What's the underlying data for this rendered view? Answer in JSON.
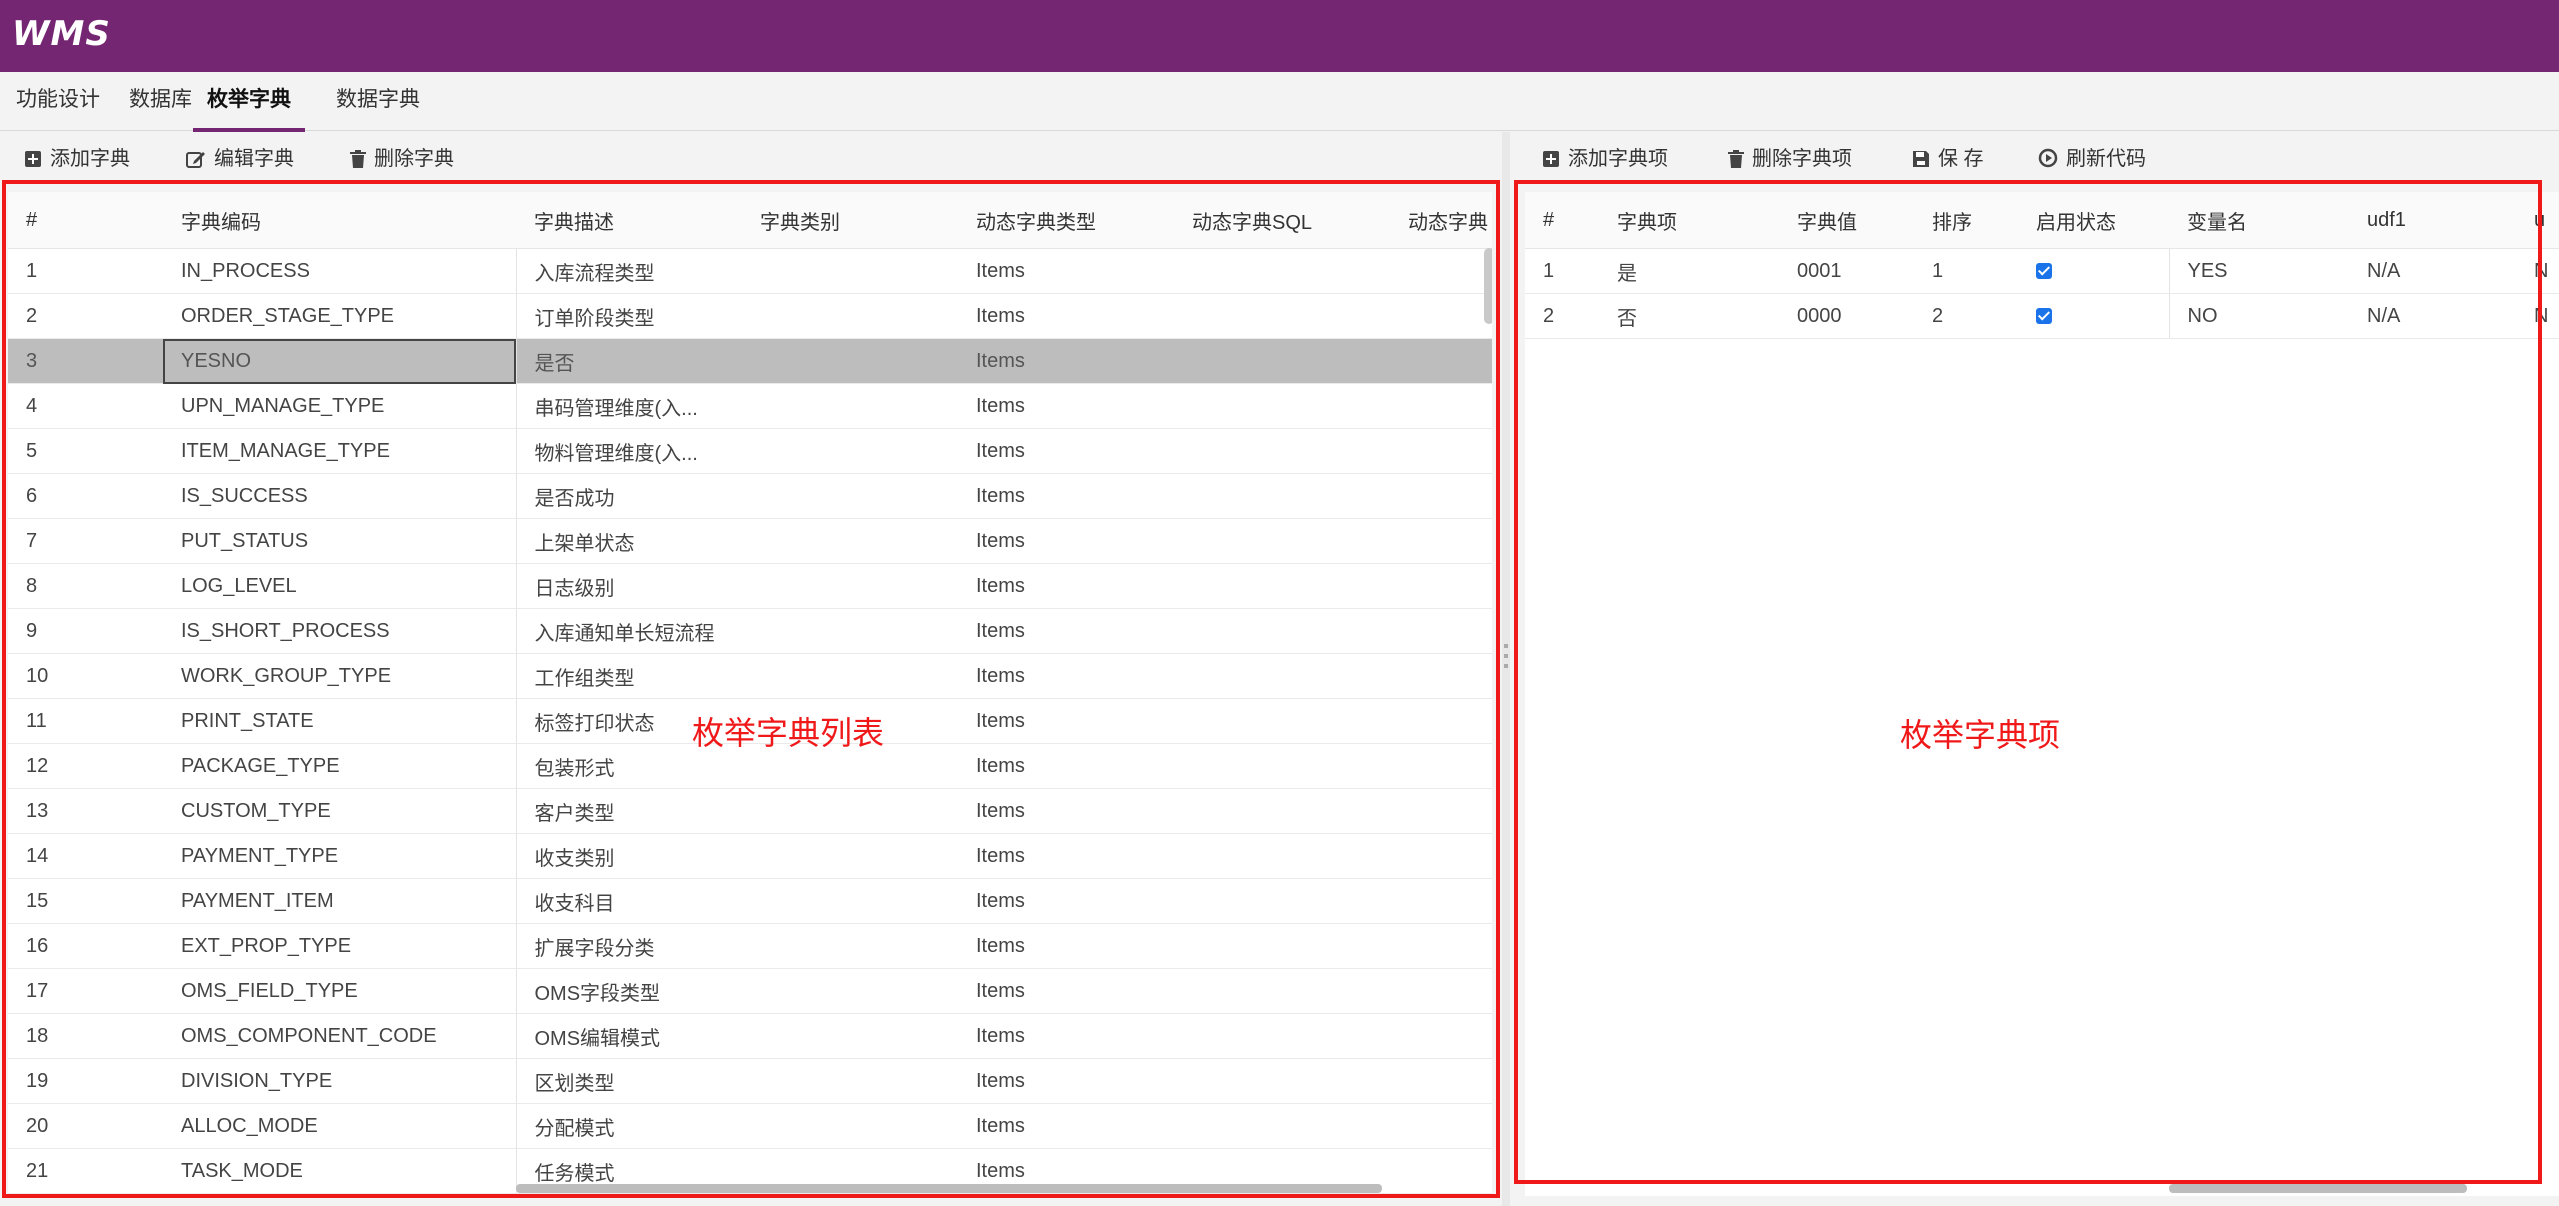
{
  "app": {
    "logo": "WMS",
    "accent": "#742673"
  },
  "tabs": [
    {
      "label": "功能设计",
      "active": false
    },
    {
      "label": "数据库",
      "active": false
    },
    {
      "label": "枚举字典",
      "active": true
    },
    {
      "label": "数据字典",
      "active": false
    }
  ],
  "left_toolbar": {
    "add": "添加字典",
    "edit": "编辑字典",
    "delete": "删除字典"
  },
  "right_toolbar": {
    "add": "添加字典项",
    "delete": "删除字典项",
    "save": "保 存",
    "refresh": "刷新代码"
  },
  "left_table": {
    "columns": [
      "#",
      "字典编码",
      "字典描述",
      "字典类别",
      "动态字典类型",
      "动态字典SQL",
      "动态字典"
    ],
    "rows": [
      [
        "1",
        "IN_PROCESS",
        "入库流程类型",
        "",
        "Items"
      ],
      [
        "2",
        "ORDER_STAGE_TYPE",
        "订单阶段类型",
        "",
        "Items"
      ],
      [
        "3",
        "YESNO",
        "是否",
        "",
        "Items"
      ],
      [
        "4",
        "UPN_MANAGE_TYPE",
        "串码管理维度(入...",
        "",
        "Items"
      ],
      [
        "5",
        "ITEM_MANAGE_TYPE",
        "物料管理维度(入...",
        "",
        "Items"
      ],
      [
        "6",
        "IS_SUCCESS",
        "是否成功",
        "",
        "Items"
      ],
      [
        "7",
        "PUT_STATUS",
        "上架单状态",
        "",
        "Items"
      ],
      [
        "8",
        "LOG_LEVEL",
        "日志级别",
        "",
        "Items"
      ],
      [
        "9",
        "IS_SHORT_PROCESS",
        "入库通知单长短流程",
        "",
        "Items"
      ],
      [
        "10",
        "WORK_GROUP_TYPE",
        "工作组类型",
        "",
        "Items"
      ],
      [
        "11",
        "PRINT_STATE",
        "标签打印状态",
        "",
        "Items"
      ],
      [
        "12",
        "PACKAGE_TYPE",
        "包装形式",
        "",
        "Items"
      ],
      [
        "13",
        "CUSTOM_TYPE",
        "客户类型",
        "",
        "Items"
      ],
      [
        "14",
        "PAYMENT_TYPE",
        "收支类别",
        "",
        "Items"
      ],
      [
        "15",
        "PAYMENT_ITEM",
        "收支科目",
        "",
        "Items"
      ],
      [
        "16",
        "EXT_PROP_TYPE",
        "扩展字段分类",
        "",
        "Items"
      ],
      [
        "17",
        "OMS_FIELD_TYPE",
        "OMS字段类型",
        "",
        "Items"
      ],
      [
        "18",
        "OMS_COMPONENT_CODE",
        "OMS编辑模式",
        "",
        "Items"
      ],
      [
        "19",
        "DIVISION_TYPE",
        "区划类型",
        "",
        "Items"
      ],
      [
        "20",
        "ALLOC_MODE",
        "分配模式",
        "",
        "Items"
      ],
      [
        "21",
        "TASK_MODE",
        "任务模式",
        "",
        "Items"
      ]
    ],
    "selected_index": 2
  },
  "right_table": {
    "columns": [
      "#",
      "字典项",
      "字典值",
      "排序",
      "启用状态",
      "变量名",
      "udf1",
      "u"
    ],
    "rows": [
      [
        "1",
        "是",
        "0001",
        "1",
        "checked",
        "YES",
        "N/A",
        "N"
      ],
      [
        "2",
        "否",
        "0000",
        "2",
        "checked",
        "NO",
        "N/A",
        "N"
      ]
    ]
  },
  "annotations": {
    "left": "枚举字典列表",
    "right": "枚举字典项",
    "color": "#f0191a"
  }
}
